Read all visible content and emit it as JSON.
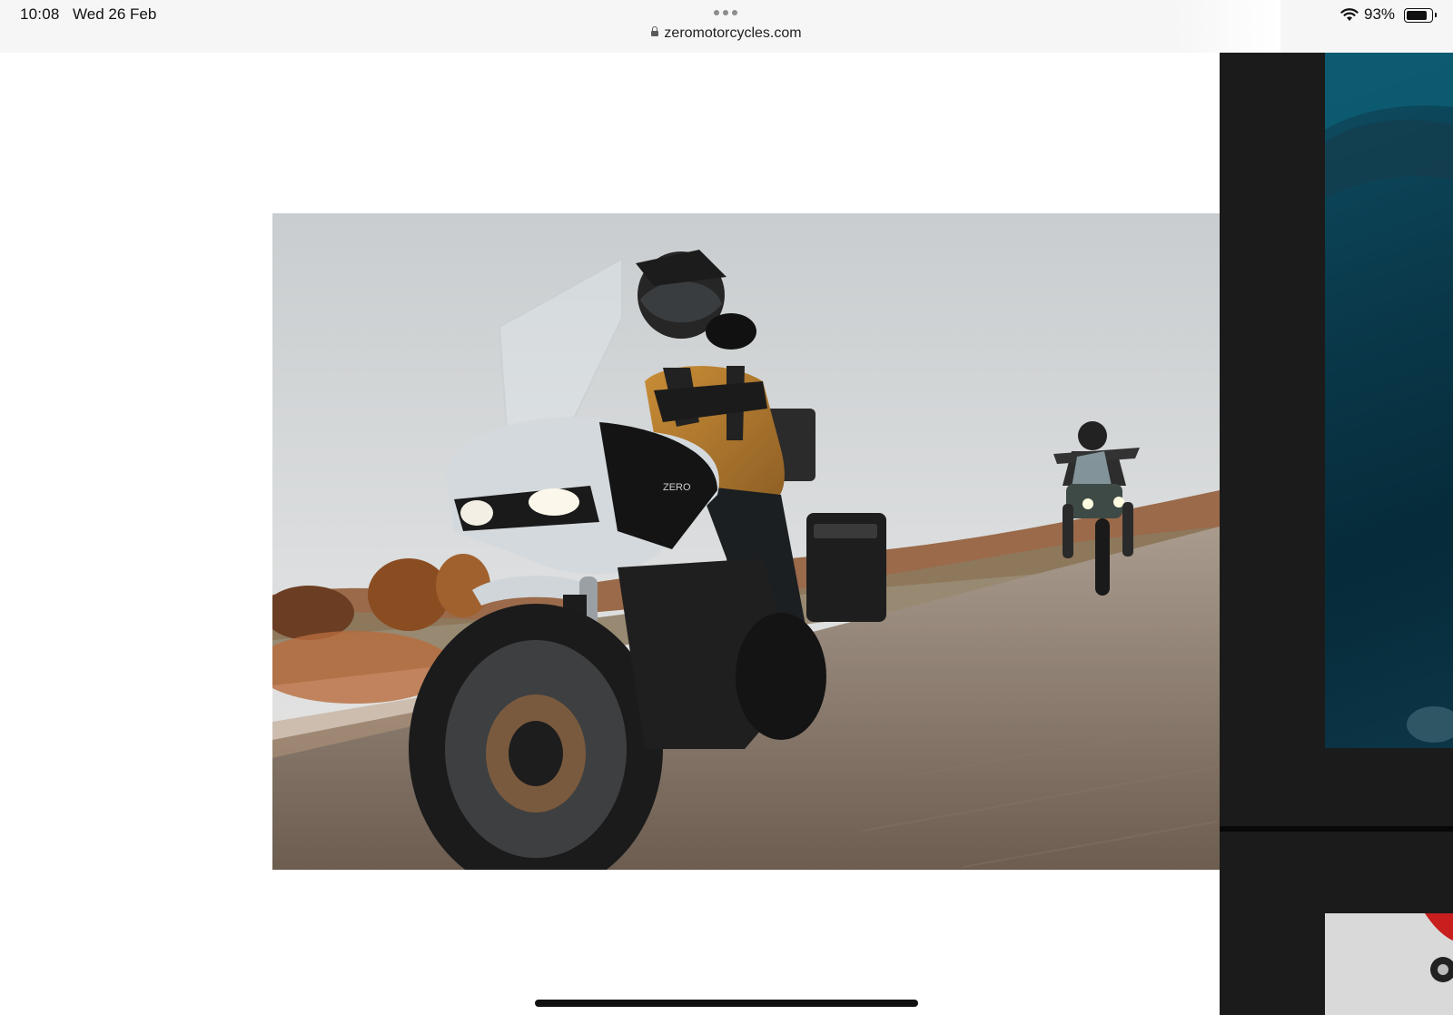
{
  "status_bar": {
    "time": "10:08",
    "date": "Wed 26 Feb",
    "battery_percent": "93%",
    "battery_level": 0.93
  },
  "address_bar": {
    "url": "zeromotorcycles.com"
  },
  "hero_image": {
    "badge_text": "ZERO"
  },
  "colors": {
    "status_bg": "#f6f6f6",
    "side_panel": "#1b1b1b"
  }
}
